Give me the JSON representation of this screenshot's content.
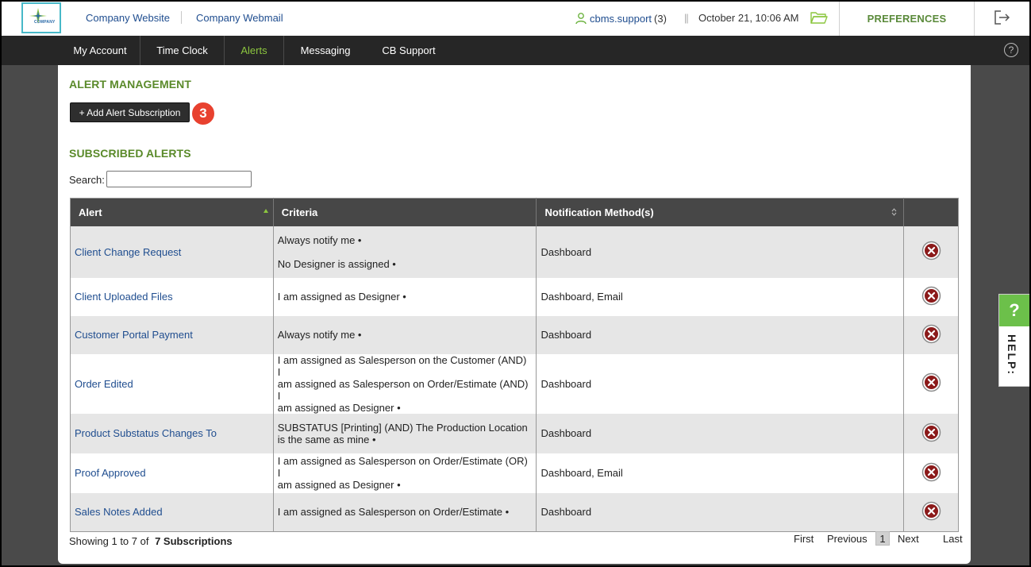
{
  "header": {
    "logo_text": "COMPANY",
    "links": [
      "Company Website",
      "Company Webmail"
    ],
    "user": "cbms.support",
    "user_count": "(3)",
    "divider": "||",
    "datetime": "October 21, 10:06 AM",
    "preferences": "PREFERENCES"
  },
  "nav": {
    "items": [
      "My Account",
      "Time Clock",
      "Alerts",
      "Messaging",
      "CB Support"
    ],
    "active": "Alerts",
    "help": "?"
  },
  "main": {
    "title": "ALERT MANAGEMENT",
    "add_button": "+ Add Alert Subscription",
    "step_badge": "3",
    "subscribed_title": "SUBSCRIBED ALERTS",
    "search_label": "Search:",
    "search_value": ""
  },
  "table": {
    "headers": [
      "Alert",
      "Criteria",
      "Notification Method(s)",
      ""
    ],
    "rows": [
      {
        "alert": "Client Change Request",
        "criteria": [
          "Always notify me •",
          "No Designer is assigned •"
        ],
        "method": "Dashboard"
      },
      {
        "alert": "Client Uploaded Files",
        "criteria": [
          "I am assigned as Designer •"
        ],
        "method": "Dashboard, Email"
      },
      {
        "alert": "Customer Portal Payment",
        "criteria": [
          "Always notify me •"
        ],
        "method": "Dashboard"
      },
      {
        "alert": "Order Edited",
        "criteria": [
          "I am assigned as Salesperson on the Customer (AND) I",
          "am assigned as Salesperson on Order/Estimate (AND) I",
          "am assigned as Designer •"
        ],
        "method": "Dashboard"
      },
      {
        "alert": "Product Substatus Changes To",
        "criteria": [
          "SUBSTATUS [Printing] (AND) The Production Location",
          "is the same as mine •"
        ],
        "method": "Dashboard"
      },
      {
        "alert": "Proof Approved",
        "criteria": [
          "I am assigned as Salesperson on Order/Estimate (OR) I",
          "am assigned as Designer •"
        ],
        "method": "Dashboard, Email"
      },
      {
        "alert": "Sales Notes Added",
        "criteria": [
          "I am assigned as Salesperson on Order/Estimate •"
        ],
        "method": "Dashboard"
      }
    ]
  },
  "footer": {
    "showing_prefix": "Showing 1 to 7 of",
    "showing_total": "7 Subscriptions",
    "pager": {
      "first": "First",
      "previous": "Previous",
      "page": "1",
      "next": "Next",
      "last": "Last"
    }
  },
  "help_tab": {
    "q": "?",
    "label": "HELP:"
  },
  "colors": {
    "accent_green": "#8cc63f",
    "title_green": "#5a8a2a",
    "link_blue": "#1f4d8f",
    "delete_red": "#8b1a1a",
    "badge_red": "#e8412f"
  },
  "icons": [
    "user-icon",
    "folder-icon",
    "logout-icon",
    "help-icon",
    "delete-icon",
    "sort-asc-icon",
    "sort-icon"
  ]
}
